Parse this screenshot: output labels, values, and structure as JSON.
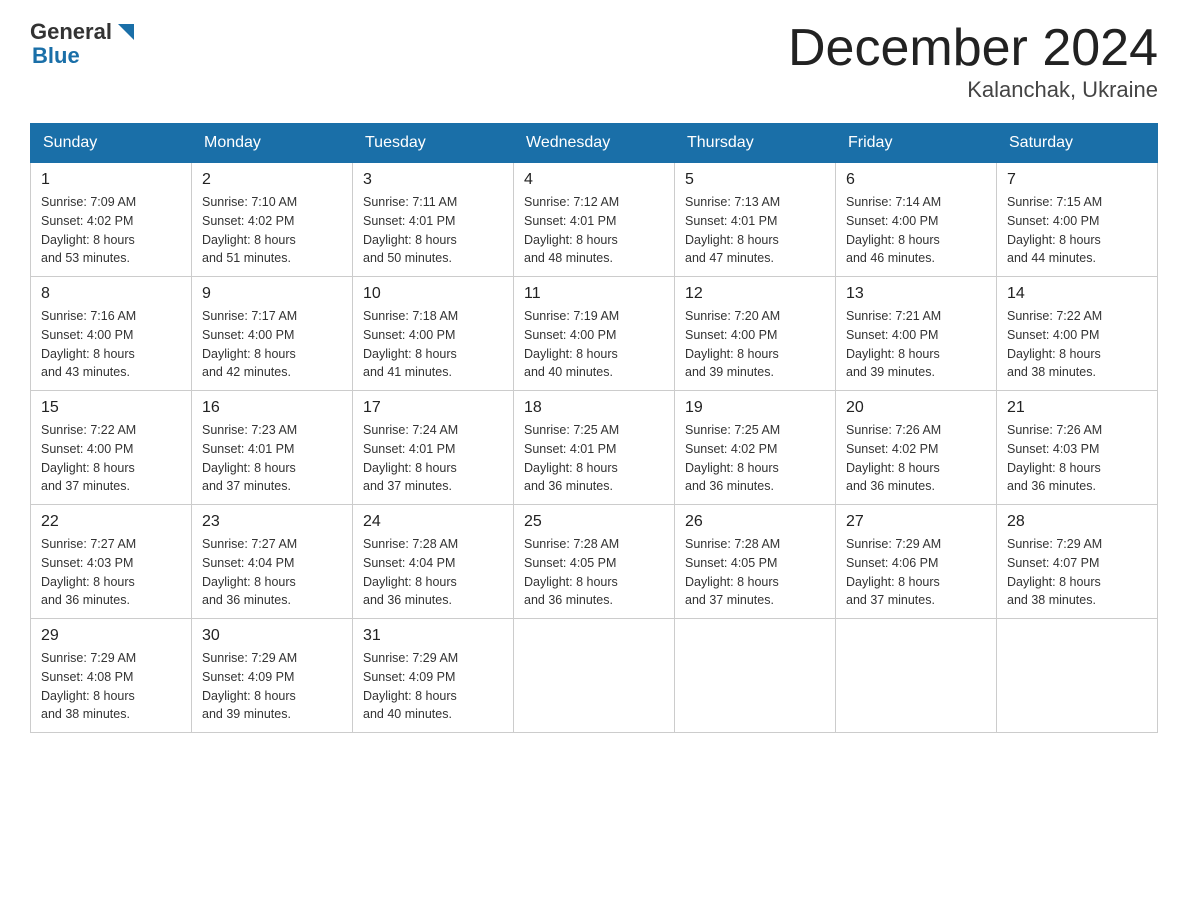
{
  "logo": {
    "general": "General",
    "blue": "Blue"
  },
  "title": "December 2024",
  "subtitle": "Kalanchak, Ukraine",
  "days_of_week": [
    "Sunday",
    "Monday",
    "Tuesday",
    "Wednesday",
    "Thursday",
    "Friday",
    "Saturday"
  ],
  "weeks": [
    [
      {
        "day": "1",
        "sunrise": "7:09 AM",
        "sunset": "4:02 PM",
        "daylight": "8 hours and 53 minutes."
      },
      {
        "day": "2",
        "sunrise": "7:10 AM",
        "sunset": "4:02 PM",
        "daylight": "8 hours and 51 minutes."
      },
      {
        "day": "3",
        "sunrise": "7:11 AM",
        "sunset": "4:01 PM",
        "daylight": "8 hours and 50 minutes."
      },
      {
        "day": "4",
        "sunrise": "7:12 AM",
        "sunset": "4:01 PM",
        "daylight": "8 hours and 48 minutes."
      },
      {
        "day": "5",
        "sunrise": "7:13 AM",
        "sunset": "4:01 PM",
        "daylight": "8 hours and 47 minutes."
      },
      {
        "day": "6",
        "sunrise": "7:14 AM",
        "sunset": "4:00 PM",
        "daylight": "8 hours and 46 minutes."
      },
      {
        "day": "7",
        "sunrise": "7:15 AM",
        "sunset": "4:00 PM",
        "daylight": "8 hours and 44 minutes."
      }
    ],
    [
      {
        "day": "8",
        "sunrise": "7:16 AM",
        "sunset": "4:00 PM",
        "daylight": "8 hours and 43 minutes."
      },
      {
        "day": "9",
        "sunrise": "7:17 AM",
        "sunset": "4:00 PM",
        "daylight": "8 hours and 42 minutes."
      },
      {
        "day": "10",
        "sunrise": "7:18 AM",
        "sunset": "4:00 PM",
        "daylight": "8 hours and 41 minutes."
      },
      {
        "day": "11",
        "sunrise": "7:19 AM",
        "sunset": "4:00 PM",
        "daylight": "8 hours and 40 minutes."
      },
      {
        "day": "12",
        "sunrise": "7:20 AM",
        "sunset": "4:00 PM",
        "daylight": "8 hours and 39 minutes."
      },
      {
        "day": "13",
        "sunrise": "7:21 AM",
        "sunset": "4:00 PM",
        "daylight": "8 hours and 39 minutes."
      },
      {
        "day": "14",
        "sunrise": "7:22 AM",
        "sunset": "4:00 PM",
        "daylight": "8 hours and 38 minutes."
      }
    ],
    [
      {
        "day": "15",
        "sunrise": "7:22 AM",
        "sunset": "4:00 PM",
        "daylight": "8 hours and 37 minutes."
      },
      {
        "day": "16",
        "sunrise": "7:23 AM",
        "sunset": "4:01 PM",
        "daylight": "8 hours and 37 minutes."
      },
      {
        "day": "17",
        "sunrise": "7:24 AM",
        "sunset": "4:01 PM",
        "daylight": "8 hours and 37 minutes."
      },
      {
        "day": "18",
        "sunrise": "7:25 AM",
        "sunset": "4:01 PM",
        "daylight": "8 hours and 36 minutes."
      },
      {
        "day": "19",
        "sunrise": "7:25 AM",
        "sunset": "4:02 PM",
        "daylight": "8 hours and 36 minutes."
      },
      {
        "day": "20",
        "sunrise": "7:26 AM",
        "sunset": "4:02 PM",
        "daylight": "8 hours and 36 minutes."
      },
      {
        "day": "21",
        "sunrise": "7:26 AM",
        "sunset": "4:03 PM",
        "daylight": "8 hours and 36 minutes."
      }
    ],
    [
      {
        "day": "22",
        "sunrise": "7:27 AM",
        "sunset": "4:03 PM",
        "daylight": "8 hours and 36 minutes."
      },
      {
        "day": "23",
        "sunrise": "7:27 AM",
        "sunset": "4:04 PM",
        "daylight": "8 hours and 36 minutes."
      },
      {
        "day": "24",
        "sunrise": "7:28 AM",
        "sunset": "4:04 PM",
        "daylight": "8 hours and 36 minutes."
      },
      {
        "day": "25",
        "sunrise": "7:28 AM",
        "sunset": "4:05 PM",
        "daylight": "8 hours and 36 minutes."
      },
      {
        "day": "26",
        "sunrise": "7:28 AM",
        "sunset": "4:05 PM",
        "daylight": "8 hours and 37 minutes."
      },
      {
        "day": "27",
        "sunrise": "7:29 AM",
        "sunset": "4:06 PM",
        "daylight": "8 hours and 37 minutes."
      },
      {
        "day": "28",
        "sunrise": "7:29 AM",
        "sunset": "4:07 PM",
        "daylight": "8 hours and 38 minutes."
      }
    ],
    [
      {
        "day": "29",
        "sunrise": "7:29 AM",
        "sunset": "4:08 PM",
        "daylight": "8 hours and 38 minutes."
      },
      {
        "day": "30",
        "sunrise": "7:29 AM",
        "sunset": "4:09 PM",
        "daylight": "8 hours and 39 minutes."
      },
      {
        "day": "31",
        "sunrise": "7:29 AM",
        "sunset": "4:09 PM",
        "daylight": "8 hours and 40 minutes."
      },
      null,
      null,
      null,
      null
    ]
  ],
  "labels": {
    "sunrise": "Sunrise:",
    "sunset": "Sunset:",
    "daylight": "Daylight:"
  }
}
